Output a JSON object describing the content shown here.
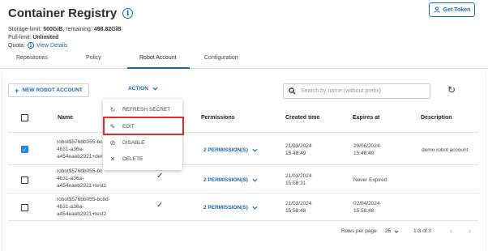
{
  "header": {
    "title": "Container Registry",
    "get_token_label": "Get Token"
  },
  "quota": {
    "storage_prefix": "Storage-limit: ",
    "storage_limit": "500GiB",
    "remaining_prefix": ", remaining: ",
    "remaining": "498.82GiB",
    "pull_prefix": "Pull-limit: ",
    "pull_limit": "Unlimited",
    "quota_label": "Quota: ",
    "view_details": "View Details"
  },
  "tabs": [
    {
      "label": "Repositories"
    },
    {
      "label": "Policy"
    },
    {
      "label": "Robot Account",
      "active": true
    },
    {
      "label": "Configuration"
    }
  ],
  "toolbar": {
    "new_robot_label": "NEW ROBOT ACCOUNT",
    "action_label": "ACTION",
    "search_placeholder": "Search by name (without prefix)"
  },
  "table": {
    "columns": {
      "name": "Name",
      "permissions": "Permissions",
      "created": "Created time",
      "expires": "Expires at",
      "description": "Description"
    },
    "rows": [
      {
        "checked": true,
        "name_lines": [
          "robot$576bb055-bc",
          "4b31-a36a-",
          "a454eaeb2921+der"
        ],
        "enabled": true,
        "permissions": "2 PERMISSION(S)",
        "created": [
          "21/03/2024",
          "15:48:49"
        ],
        "expires": [
          "29/06/2024",
          "15:48:49"
        ],
        "description": "demo robot account"
      },
      {
        "checked": false,
        "name_lines": [
          "robot$576bb055-bc",
          "4b31-a36a-",
          "a454eaeb2921+test1"
        ],
        "enabled": true,
        "permissions": "2 PERMISSION(S)",
        "created": [
          "21/03/2024",
          "15:58:31"
        ],
        "expires": [
          "Never Expired"
        ],
        "description": ""
      },
      {
        "checked": false,
        "name_lines": [
          "robot$576bb055-bc8d-",
          "4b31-a36a-",
          "a454eaeb2921+test2"
        ],
        "enabled": true,
        "permissions": "2 PERMISSION(S)",
        "created": [
          "21/03/2024",
          "15:58:48"
        ],
        "expires": [
          "02/04/2024",
          "15:58:48"
        ],
        "description": ""
      }
    ]
  },
  "action_menu": {
    "items": [
      {
        "label": "REFRESH SECRET",
        "icon": "refresh-icon"
      },
      {
        "label": "EDIT",
        "icon": "pencil-icon",
        "highlighted": true
      },
      {
        "label": "DISABLE",
        "icon": "block-icon"
      },
      {
        "label": "DELETE",
        "icon": "close-icon"
      }
    ]
  },
  "footer": {
    "rows_per_page_label": "Rows per page:",
    "rows_per_page_value": "25",
    "range": "1-3 of 3"
  },
  "colors": {
    "accent": "#1565c0",
    "highlight_border": "#d32f2f",
    "checkbox_checked": "#1e88e5"
  }
}
